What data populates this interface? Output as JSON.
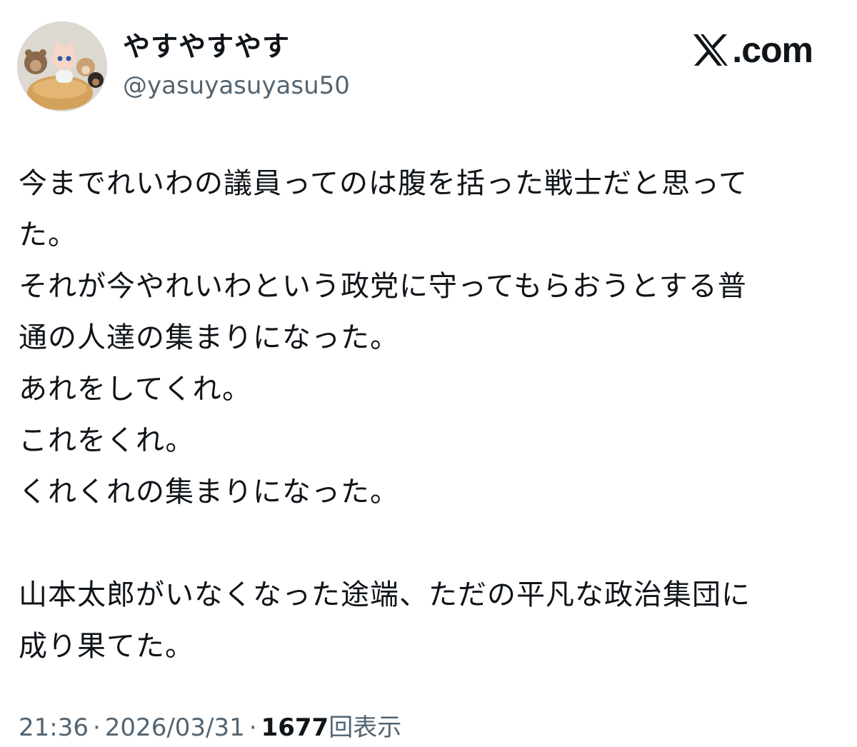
{
  "author": {
    "display_name": "やすやすやす",
    "handle": "@yasuyasuyasu50",
    "avatar_icon": "avatar-plush-toys"
  },
  "brand": {
    "icon": "x-logo-icon",
    "label": "X",
    "suffix": ".com"
  },
  "tweet": {
    "lines": [
      "今までれいわの議員ってのは腹を括った戦士だと思って",
      "た。",
      "それが今やれいわという政党に守ってもらおうとする普",
      "通の人達の集まりになった。",
      "あれをしてくれ。",
      "これをくれ。",
      "くれくれの集まりになった。",
      "",
      "山本太郎がいなくなった途端、ただの平凡な政治集団に",
      "成り果てた。"
    ]
  },
  "meta": {
    "time": "21:36",
    "separator": "·",
    "date": "2026/03/31",
    "views_count": "1677",
    "views_label": "回表示"
  },
  "colors": {
    "text_primary": "#0f1419",
    "text_secondary": "#536471",
    "background": "#ffffff"
  }
}
